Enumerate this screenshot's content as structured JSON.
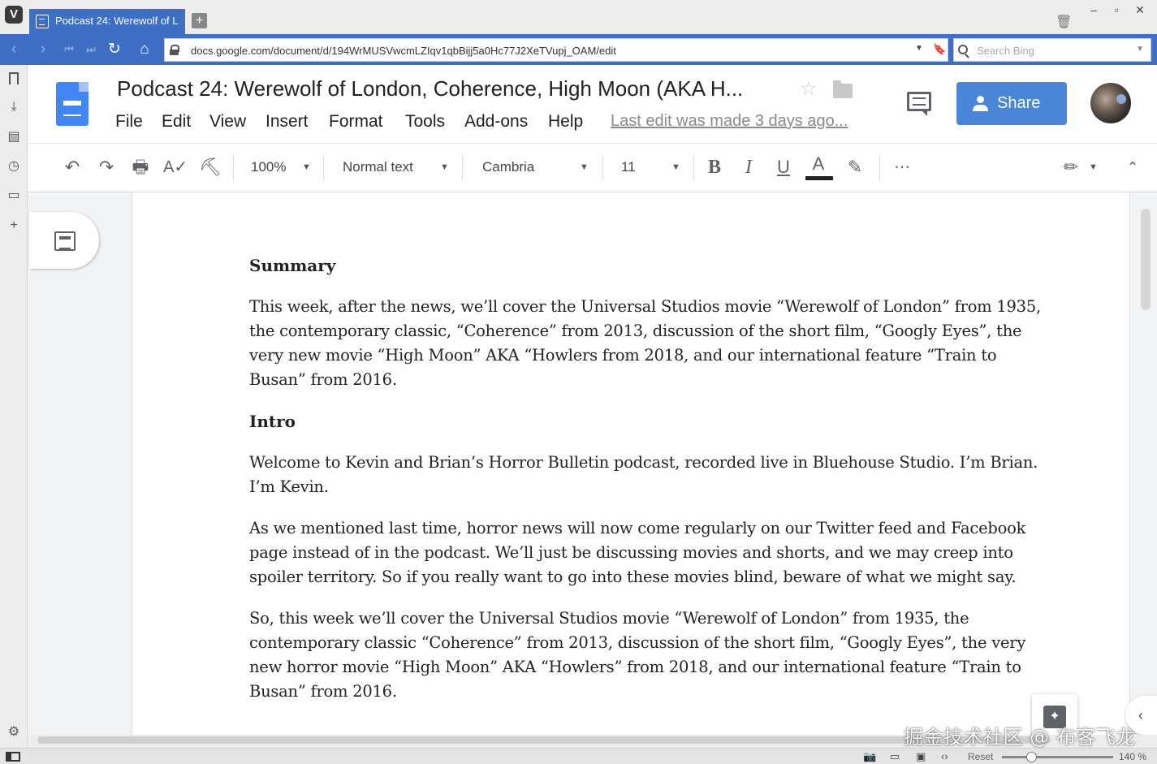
{
  "browser": {
    "tab_title": "Podcast 24: Werewolf of L",
    "url": "docs.google.com/document/d/194WrMUSVwcmLZIqv1qbBijj5a0Hc77J2XeTVupj_OAM/edit",
    "search_placeholder": "Search Bing",
    "zoom_reset_label": "Reset",
    "zoom_level": "140 %"
  },
  "docs": {
    "title": "Podcast 24: Werewolf of London, Coherence, High Moon (AKA H...",
    "menu": [
      "File",
      "Edit",
      "View",
      "Insert",
      "Format",
      "Tools",
      "Add-ons",
      "Help"
    ],
    "last_edit": "Last edit was made 3 days ago...",
    "share_label": "Share"
  },
  "toolbar": {
    "zoom": "100%",
    "style": "Normal text",
    "font": "Cambria",
    "size": "11",
    "bold": "B",
    "italic": "I",
    "underline": "U",
    "text_color": "A",
    "more": "⋯"
  },
  "document": {
    "summary_heading": "Summary",
    "summary_text": "This week, after the news, we’ll cover the Universal Studios movie “Werewolf of London” from 1935, the contemporary classic, “Coherence” from 2013, discussion of the short film, “Googly Eyes”, the very new movie “High Moon” AKA “Howlers from 2018, and our international feature “Train to Busan” from 2016.",
    "intro_heading": "Intro",
    "intro_p1": "Welcome to Kevin and Brian’s Horror Bulletin podcast, recorded live in Bluehouse Studio. I’m Brian. I’m Kevin.",
    "intro_p2": "As we mentioned last time, horror news will now come regularly on our Twitter feed and Facebook page instead of in the podcast. We’ll just be discussing movies and shorts, and we may creep into spoiler territory. So if you really want to go into these movies blind, beware of what we might say.",
    "intro_p3": "So,  this week we’ll cover the Universal Studios movie “Werewolf of London” from 1935, the contemporary classic “Coherence” from 2013, discussion of the short film, “Googly Eyes”, the very new horror movie “High Moon” AKA “Howlers” from 2018, and our international feature “Train to Busan” from 2016."
  },
  "watermark": "掘金技术社区 @ 布客飞龙",
  "colors": {
    "browser_accent": "#3f6fc4",
    "docs_blue": "#4285f4",
    "share_button": "#4a86d8",
    "page_background": "#f1f3f4"
  },
  "icons": [
    "app-logo-icon",
    "docs-tab-icon",
    "new-tab-icon",
    "trash-icon",
    "minimize-icon",
    "maximize-icon",
    "close-icon",
    "back-icon",
    "forward-icon",
    "rewind-icon",
    "fast-forward-icon",
    "reload-icon",
    "home-icon",
    "lock-icon",
    "bookmark-icon",
    "search-icon",
    "docs-logo-icon",
    "star-icon",
    "folder-icon",
    "comment-icon",
    "share-person-icon",
    "undo-icon",
    "redo-icon",
    "print-icon",
    "spellcheck-icon",
    "paint-format-icon",
    "highlighter-icon",
    "pencil-edit-icon",
    "collapse-icon",
    "outline-icon",
    "explore-icon",
    "chevron-left-icon",
    "gear-icon",
    "camera-icon",
    "window-icon",
    "image-icon",
    "code-icon"
  ]
}
